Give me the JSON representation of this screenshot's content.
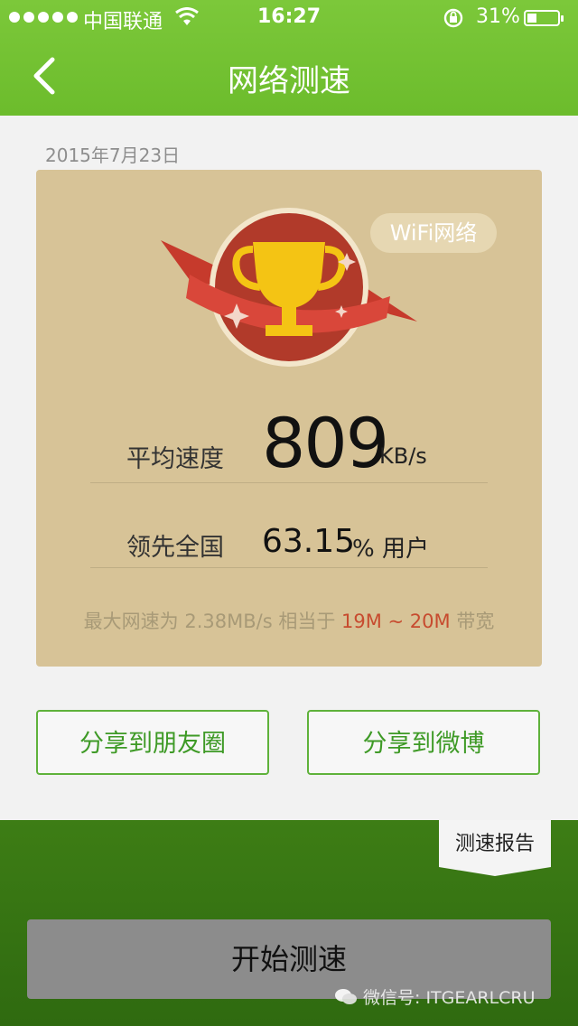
{
  "status_bar": {
    "carrier": "中国联通",
    "time": "16:27",
    "battery_percent": "31%",
    "battery_level": 0.31
  },
  "nav": {
    "title": "网络测速",
    "back_icon": "chevron-left-icon"
  },
  "result": {
    "date": "2015年7月23日",
    "network_type": "WiFi网络",
    "badge_icon": "trophy-icon",
    "avg_speed_label": "平均速度",
    "avg_speed_value": "809",
    "avg_speed_unit": "KB/s",
    "rank_label": "领先全国",
    "rank_value": "63.15",
    "rank_suffix": "% 用户",
    "note_prefix": "最大网速为 2.38MB/s 相当于 ",
    "note_highlight": "19M ~ 20M",
    "note_suffix": " 带宽"
  },
  "share": {
    "moments_label": "分享到朋友圈",
    "weibo_label": "分享到微博"
  },
  "footer": {
    "report_tab_label": "测速报告",
    "start_button_label": "开始测速",
    "watermark_text": "微信号: ITGEARLCRU"
  },
  "colors": {
    "header_green": "#6cbc2c",
    "card_tan": "#d7c397",
    "badge_red": "#b13a2a",
    "trophy_gold": "#f4c414",
    "highlight_red": "#c74b2f",
    "footer_green": "#3d7d15"
  }
}
